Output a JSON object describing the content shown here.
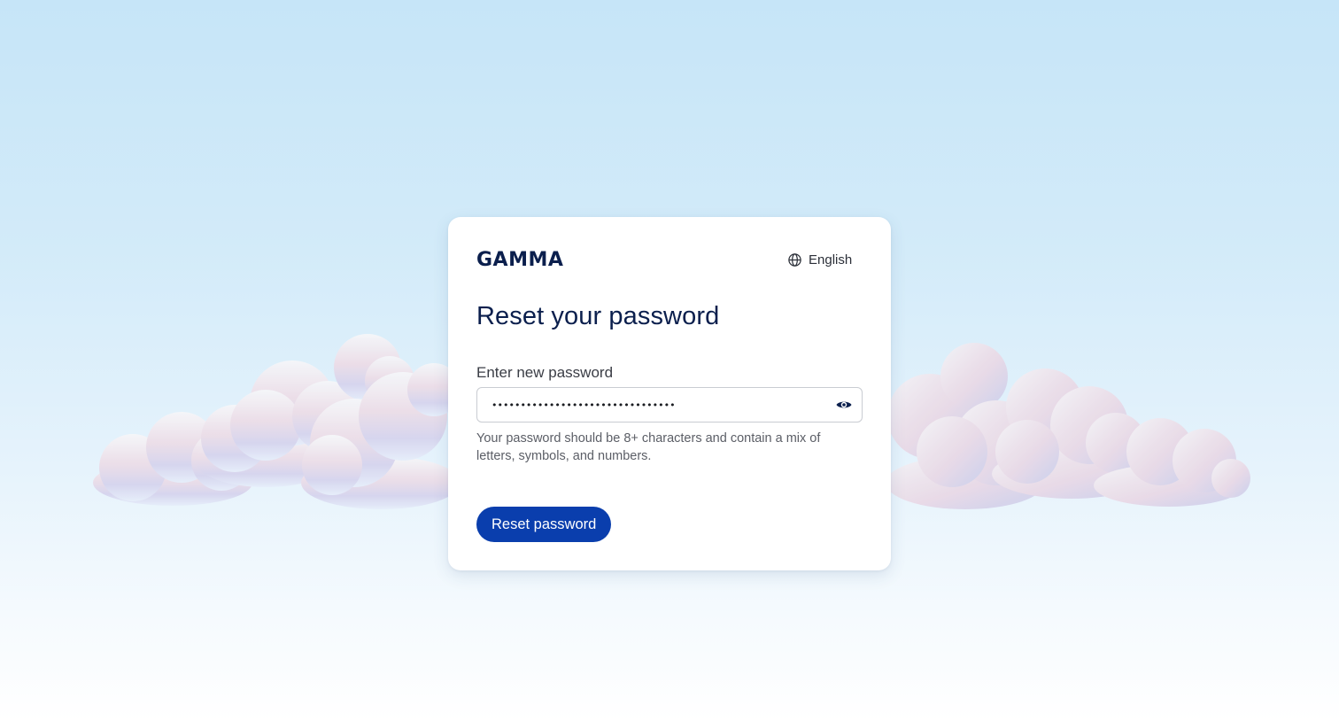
{
  "brand": {
    "logo_text": "GAMMA",
    "logo_color": "#0b1f4d"
  },
  "language": {
    "label": "English",
    "icon": "globe-icon"
  },
  "form": {
    "title": "Reset your password",
    "password_label": "Enter new password",
    "password_value": "••••••••••••••••••••••••••••••••",
    "toggle_icon": "eye-icon",
    "hint": "Your password should be 8+ characters and contain a mix of letters, symbols, and numbers.",
    "submit_label": "Reset password"
  },
  "colors": {
    "primary": "#0a3ead",
    "heading": "#0b1f4d",
    "background_top": "#c6e5f8",
    "background_bottom": "#ffffff"
  }
}
